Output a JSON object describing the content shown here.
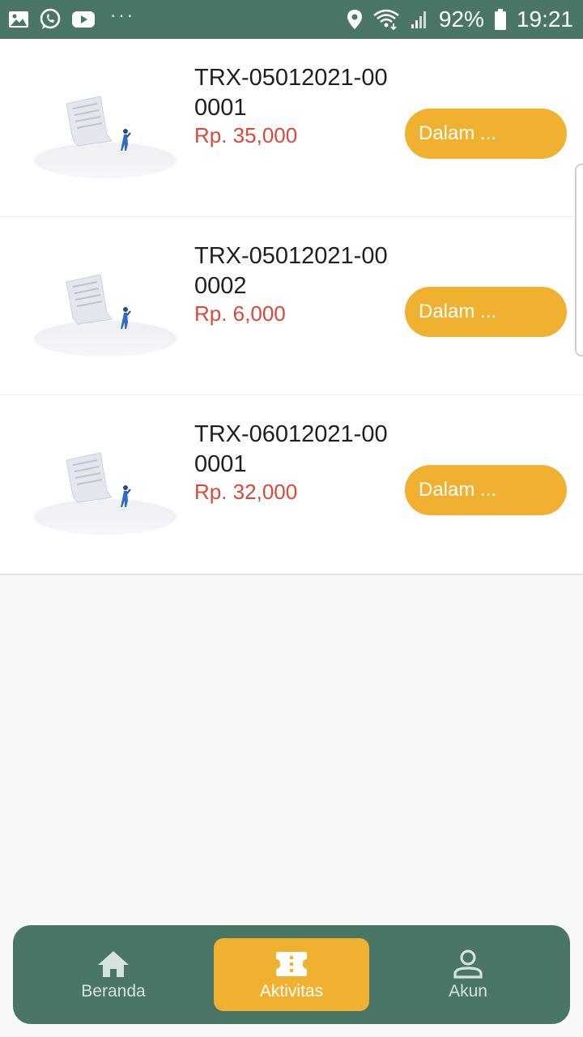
{
  "status_bar": {
    "notification_icons": [
      "gallery-icon",
      "whatsapp-icon",
      "youtube-icon"
    ],
    "more_dots": "···",
    "battery": "92%",
    "time": "19:21",
    "status_icons": [
      "location-icon",
      "wifi-icon",
      "signal-icon",
      "battery-icon"
    ]
  },
  "transactions": [
    {
      "id": "TRX-05012021-000001",
      "amount": "Rp. 35,000",
      "status": "Dalam ..."
    },
    {
      "id": "TRX-05012021-000002",
      "amount": "Rp. 6,000",
      "status": "Dalam ..."
    },
    {
      "id": "TRX-06012021-000001",
      "amount": "Rp. 32,000",
      "status": "Dalam ..."
    }
  ],
  "bottom_nav": {
    "items": [
      {
        "label": "Beranda",
        "icon": "home-icon",
        "active": false
      },
      {
        "label": "Aktivitas",
        "icon": "ticket-icon",
        "active": true
      },
      {
        "label": "Akun",
        "icon": "user-icon",
        "active": false
      }
    ]
  },
  "colors": {
    "header": "#4a7666",
    "accent": "#f0b030",
    "amount": "#d9493a",
    "background": "#f8f8f8"
  }
}
